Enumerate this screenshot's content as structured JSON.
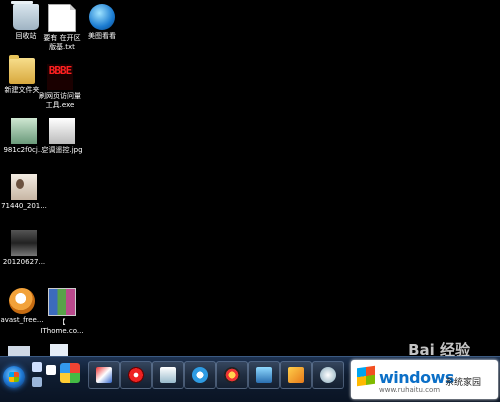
{
  "desktop": {
    "icons": [
      {
        "label": "回收站",
        "name": "recycle-bin-icon"
      },
      {
        "label": "要有 在开区\n版基.txt",
        "name": "text-file-icon"
      },
      {
        "label": "美图看看",
        "name": "image-viewer-icon"
      },
      {
        "label": "新建文件夹",
        "name": "folder-icon"
      },
      {
        "label": "刷网页访问量\n工具.exe",
        "name": "exe-icon"
      },
      {
        "label": "981c2f0cj...",
        "name": "image-thumb-icon"
      },
      {
        "label": "空调遥控.jpg",
        "name": "jpg-file-icon"
      },
      {
        "label": "71440_201...",
        "name": "photo-thumb-icon"
      },
      {
        "label": "20120627...",
        "name": "dark-thumb-icon"
      },
      {
        "label": "avast_free...",
        "name": "avast-icon"
      },
      {
        "label": "【\nIThome.co...",
        "name": "winrar-archive-icon"
      }
    ],
    "exe_glyph": "BBBE"
  },
  "taskbar": {
    "buttons": [
      "app-1",
      "app-2",
      "media-player",
      "app-4",
      "sogou",
      "qq",
      "monitor",
      "app-8",
      "app-9"
    ]
  },
  "watermark": {
    "baidu": "Bai 经验",
    "windows_brand": "windows",
    "windows_sub": "系统家园",
    "windows_url": "www.ruhaitu.com"
  }
}
